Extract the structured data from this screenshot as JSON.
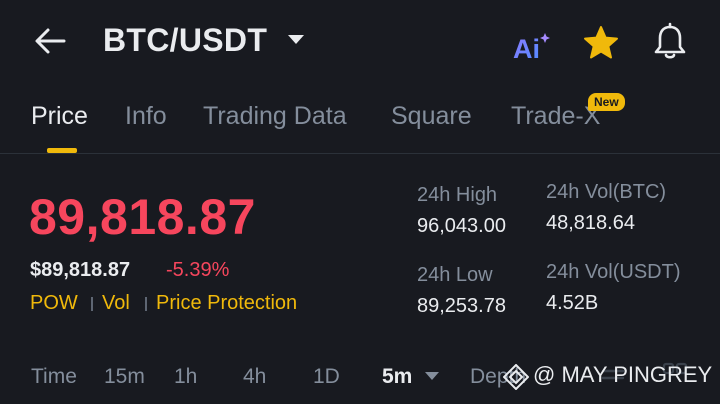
{
  "header": {
    "pair": "BTC/USDT",
    "ai_label": "Ai"
  },
  "tabs": [
    {
      "label": "Price",
      "active": true
    },
    {
      "label": "Info"
    },
    {
      "label": "Trading Data"
    },
    {
      "label": "Square"
    },
    {
      "label": "Trade-X",
      "badge": "New"
    }
  ],
  "price": {
    "last": "89,818.87",
    "usd": "$89,818.87",
    "change": "-5.39%"
  },
  "tags": [
    "POW",
    "Vol",
    "Price Protection"
  ],
  "stats": {
    "high_label": "24h High",
    "high_value": "96,043.00",
    "low_label": "24h Low",
    "low_value": "89,253.78",
    "vol_btc_label": "24h Vol(BTC)",
    "vol_btc_value": "48,818.64",
    "vol_usdt_label": "24h Vol(USDT)",
    "vol_usdt_value": "4.52B"
  },
  "intervals": {
    "time": "Time",
    "m15": "15m",
    "h1": "1h",
    "h4": "4h",
    "d1": "1D",
    "m5": "5m",
    "depth": "Depth"
  },
  "watermark": "@ MAY PINGREY",
  "colors": {
    "background": "#181a20",
    "accent": "#f0b90b",
    "down": "#f6465d",
    "muted": "#848e9c"
  }
}
